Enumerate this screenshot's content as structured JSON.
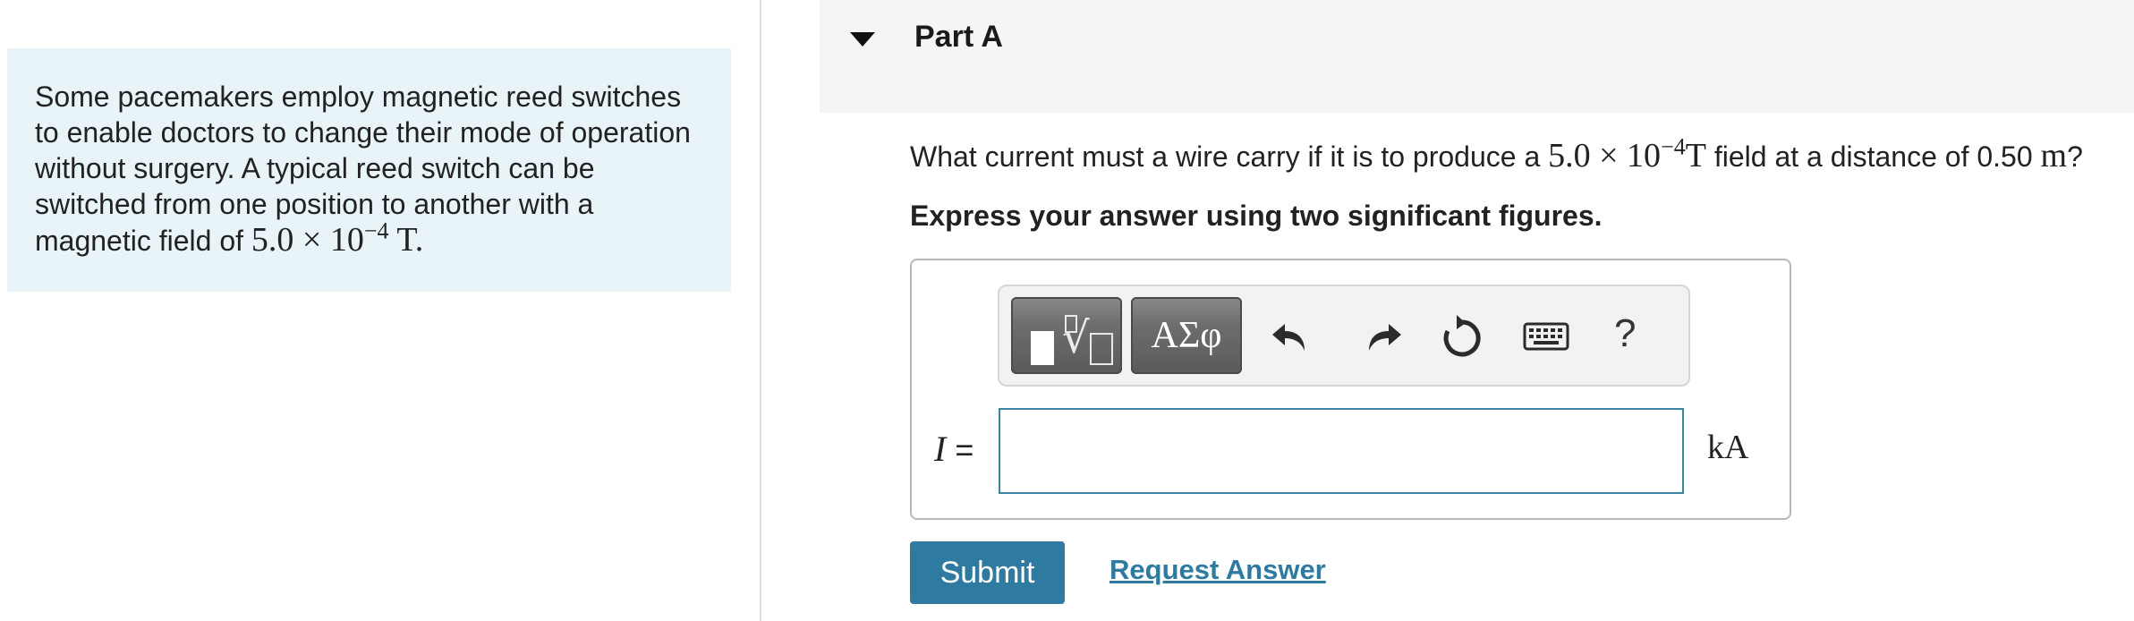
{
  "intro": {
    "text": "Some pacemakers employ magnetic reed switches to enable doctors to change their mode of operation without surgery. A typical reed switch can be switched from one position to another with a magnetic field of",
    "field_mantissa": "5.0 × 10",
    "field_exponent": "−4",
    "field_unit": " T."
  },
  "part": {
    "title": "Part A",
    "expanded": true
  },
  "question": {
    "prefix": "What current must a wire carry if it is to produce a ",
    "field_mantissa": "5.0 × 10",
    "field_exponent": "−4",
    "field_unit": "T",
    "middle": " field at a distance of 0.50 ",
    "distance_unit": "m",
    "suffix": "?"
  },
  "instruction": "Express your answer using two significant figures.",
  "toolbar": {
    "templates_icon": "templates-radical-icon",
    "greek_label": "ΑΣφ",
    "undo_icon": "undo-icon",
    "redo_icon": "redo-icon",
    "reset_icon": "reset-icon",
    "keyboard_icon": "keyboard-icon",
    "help_label": "?"
  },
  "answer": {
    "variable": "I",
    "equals": " =",
    "value": "",
    "unit": "kA"
  },
  "actions": {
    "submit_label": "Submit",
    "request_label": "Request Answer"
  },
  "colors": {
    "intro_bg": "#e8f4f7",
    "header_bg": "#f5f5f5",
    "accent": "#2f7aa0",
    "input_border": "#3a84a3"
  }
}
